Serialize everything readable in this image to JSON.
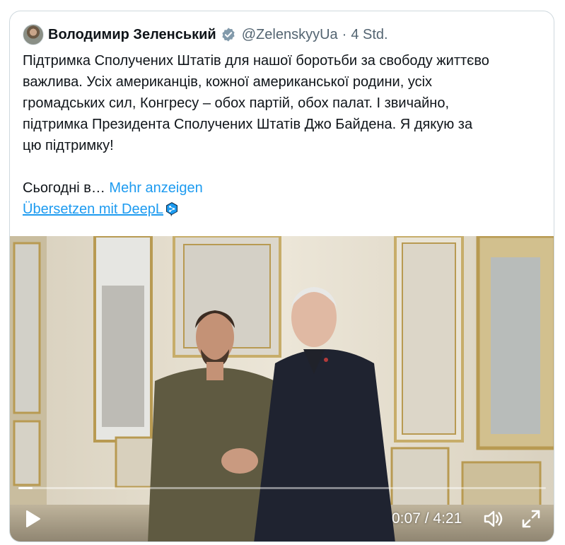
{
  "tweet": {
    "author_name": "Володимир Зеленський",
    "handle": "@ZelenskyyUa",
    "separator": "·",
    "time": "4 Std.",
    "text_lines": [
      "Підтримка Сполучених Штатів для нашої боротьби за свободу життєво",
      "важлива. Усіх американців, кожної американської родини, усіх",
      "громадських сил, Конгресу – обох партій, обох палат. І звичайно,",
      "підтримка Президента Сполучених Штатів Джо Байдена. Я дякую за",
      "цю підтримку!"
    ],
    "truncated_text": "Сьогодні в… ",
    "show_more_label": "Mehr anzeigen",
    "translate_label": "Übersetzen mit DeepL "
  },
  "video": {
    "current_time": "0:07",
    "time_separator": " / ",
    "duration": "4:21",
    "progress_fraction": 0.027
  },
  "icons": {
    "verified": "verified-badge-icon",
    "deepl": "deepl-icon",
    "play": "play-icon",
    "volume": "volume-icon",
    "fullscreen": "fullscreen-icon"
  },
  "colors": {
    "link": "#1d9bf0",
    "text": "#0f1419",
    "muted": "#536471"
  }
}
